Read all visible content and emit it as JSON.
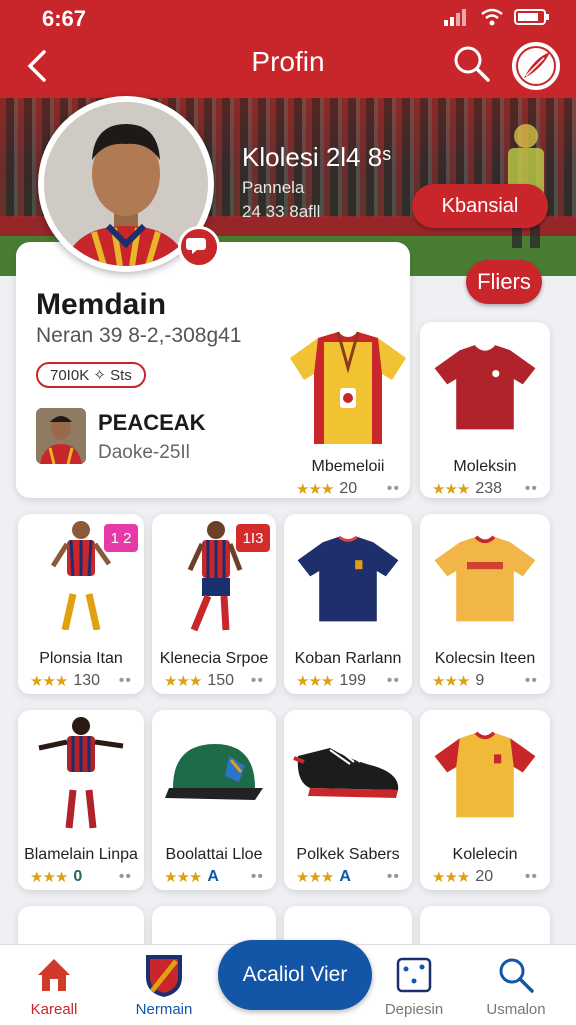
{
  "status_bar": {
    "time": "6:67"
  },
  "app_bar": {
    "title": "Profin"
  },
  "banner": {
    "title": "Klolesi 2l4 8ˢ",
    "line1": "Pannela",
    "line2": "24 33 8afll",
    "action_label": "Kbansial"
  },
  "profile": {
    "name": "Memdain",
    "subtitle": "Neran 39 8-2,-308g41",
    "badge": "70I0K ✧ Sts",
    "filter_label": "Fliers",
    "friend": {
      "name": "PEACEAK",
      "sub": "Daoke-25Il"
    }
  },
  "featured": [
    {
      "name": "Mbemeloii",
      "value": "20"
    },
    {
      "name": "Moleksin",
      "value": "238"
    }
  ],
  "grid_row1": [
    {
      "name": "Plonsia Itan",
      "value": "130",
      "tag": "1 2"
    },
    {
      "name": "Klenecia Srpoe",
      "value": "150",
      "tag": "1I3"
    },
    {
      "name": "Koban Rarlann",
      "value": "199"
    },
    {
      "name": "Kolecsin Iteen",
      "value": "9"
    }
  ],
  "grid_row2": [
    {
      "name": "Blamelain Linpa",
      "value": "0"
    },
    {
      "name": "Boolattai Lloe",
      "value": "A"
    },
    {
      "name": "Polkek Sabers",
      "value": "A"
    },
    {
      "name": "Kolelecin",
      "value": "20"
    }
  ],
  "bottom_nav": {
    "home": "Kareall",
    "team": "Nermain",
    "cta": "Acaliol Vier",
    "depth": "Depiesin",
    "search": "Usmalon"
  },
  "colors": {
    "brand_red": "#c8262b",
    "cta_blue": "#1356a8",
    "star": "#e0a010"
  }
}
